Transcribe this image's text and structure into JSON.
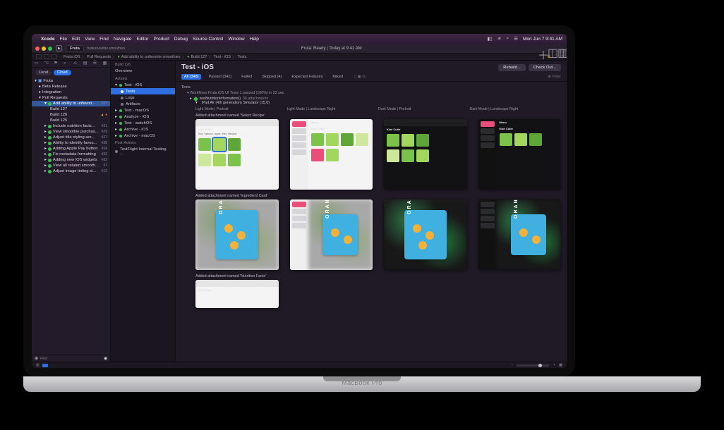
{
  "menubar": {
    "app": "Xcode",
    "items": [
      "File",
      "Edit",
      "View",
      "Find",
      "Navigate",
      "Editor",
      "Product",
      "Debug",
      "Source Control",
      "Window",
      "Help"
    ],
    "clock": "Mon Jun 7  9:41 AM"
  },
  "toolbar": {
    "project": "Fruta",
    "branch": "feature/unfav-smoothies",
    "scheme": "Fruta iOS",
    "destination": "iPad Air (4th generation)",
    "status": "Fruta: Ready | Today at 9:41 AM"
  },
  "breadcrumb": [
    "Fruta iOS",
    "Pull Requests",
    "Add ability to unfavorite smoothies",
    "Build 127",
    "Test - iOS",
    "Tests"
  ],
  "nav": {
    "pills": {
      "local": "Local",
      "cloud": "Cloud",
      "active": "cloud"
    },
    "root": "Fruta",
    "groups": [
      {
        "label": "Beta Release"
      },
      {
        "label": "Integration"
      },
      {
        "label": "Pull Requests",
        "children": [
          {
            "label": "Add ability to unfavori...",
            "badge": "#37",
            "selected": true,
            "builds": [
              {
                "label": "Build 127"
              },
              {
                "label": "Build 126",
                "warn": true,
                "err": true
              },
              {
                "label": "Build 125"
              }
            ]
          },
          {
            "label": "Include nutrition facts...",
            "badge": "#31",
            "ok": true
          },
          {
            "label": "View smoothie purchas...",
            "badge": "#29",
            "ok": true
          },
          {
            "label": "Adjust title styling acr...",
            "badge": "#27",
            "ok": true
          },
          {
            "label": "Ability to identify favou...",
            "badge": "#38",
            "ok": true
          },
          {
            "label": "Adding Apple Pay button",
            "badge": "#34",
            "ok": true
          },
          {
            "label": "Fix metadata formatting",
            "badge": "#33",
            "ok": true
          },
          {
            "label": "Adding new iOS widgets",
            "badge": "#32",
            "ok": true
          },
          {
            "label": "View all related smooth...",
            "badge": "#7",
            "ok": true
          },
          {
            "label": "Adjust image tinting sl...",
            "badge": "#12",
            "ok": true
          }
        ]
      }
    ],
    "filter_placeholder": "Filter"
  },
  "outline": {
    "build": "Build 126",
    "sections": {
      "overview": "Overview",
      "actions": "Actions",
      "items": [
        {
          "label": "Test - iOS",
          "children": [
            "Tests",
            "Logs",
            "Artifacts"
          ],
          "selected_child": 0
        },
        {
          "label": "Test - macOS"
        },
        {
          "label": "Analyze - iOS"
        },
        {
          "label": "Test - watchOS"
        },
        {
          "label": "Archive - iOS"
        },
        {
          "label": "Archive - macOS"
        }
      ],
      "post": "Post-Actions",
      "post_items": [
        "TestFlight Internal Testing ..."
      ]
    }
  },
  "detail": {
    "title": "Test - iOS",
    "rebuild": "Rebuild...",
    "checkout": "Check Out...",
    "filters": {
      "all": "All (348)",
      "passed": "Passed (342)",
      "failed": "Failed",
      "skipped": "Skipped (4)",
      "expected": "Expected Failures",
      "mixed": "Mixed"
    },
    "filter_placeholder": "Filter",
    "tests_label": "Tests",
    "workflow": "Workflows   Fruta iOS UI Tests   1 passed (100%) in 22 sec.",
    "test_name": "testNutritionInformation()",
    "test_attachments": "36 attachments",
    "device": "iPad Air (4th generation) Simulator (15.0)",
    "variants": [
      "Light Mode | Portrait",
      "Light Mode | Landscape Right",
      "Dark Mode | Portrait",
      "Dark Mode | Landscape Right"
    ],
    "attach1": "Added attachment named 'Select Recipe'",
    "attach2": "Added attachment named 'Ingredient Card'",
    "attach3": "Added attachment named 'Nutrition Facts'",
    "shot_hdr": "Kiwi Cutie",
    "shot_menu": "Menu",
    "card_text": "ORANGE"
  },
  "macbook_label": "MacBook Pro"
}
